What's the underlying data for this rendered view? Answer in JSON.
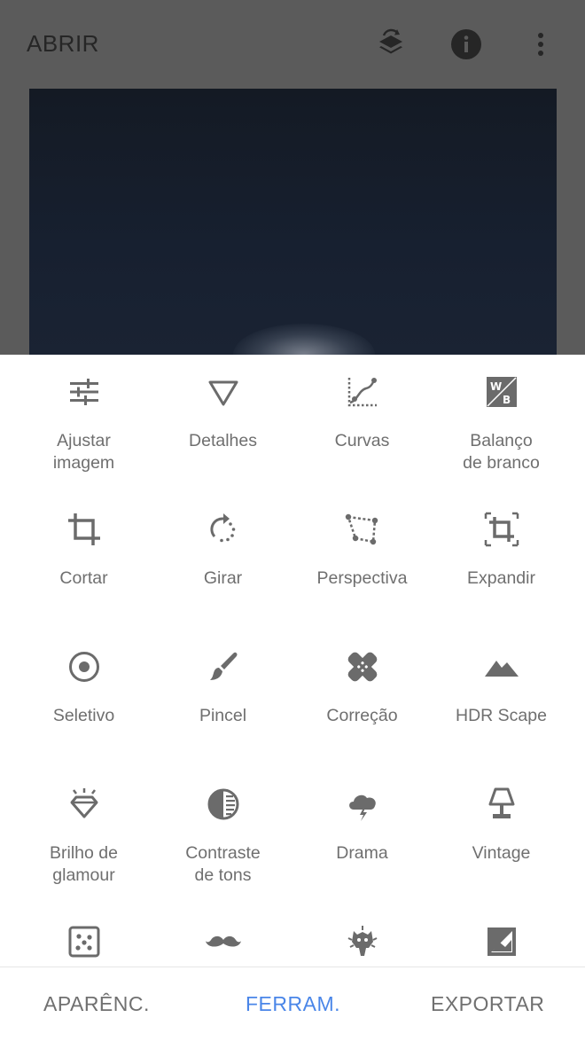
{
  "header": {
    "open_label": "ABRIR",
    "icons": [
      "layers-undo-icon",
      "info-icon",
      "more-vert-icon"
    ]
  },
  "colors": {
    "active": "#4a86e8",
    "icon": "#6b6b6b",
    "label": "#6f6f6f",
    "header_bg": "#5b5b5b"
  },
  "tools": [
    {
      "label": "Ajustar\nimagem",
      "icon": "tune-sliders-icon"
    },
    {
      "label": "Detalhes",
      "icon": "triangle-details-icon"
    },
    {
      "label": "Curvas",
      "icon": "curves-icon"
    },
    {
      "label": "Balanço\nde branco",
      "icon": "white-balance-icon"
    },
    {
      "label": "Cortar",
      "icon": "crop-icon"
    },
    {
      "label": "Girar",
      "icon": "rotate-icon"
    },
    {
      "label": "Perspectiva",
      "icon": "perspective-icon"
    },
    {
      "label": "Expandir",
      "icon": "expand-icon"
    },
    {
      "label": "Seletivo",
      "icon": "selective-icon"
    },
    {
      "label": "Pincel",
      "icon": "brush-icon"
    },
    {
      "label": "Correção",
      "icon": "healing-icon"
    },
    {
      "label": "HDR Scape",
      "icon": "hdr-mountains-icon"
    },
    {
      "label": "Brilho de\nglamour",
      "icon": "glamour-diamond-icon"
    },
    {
      "label": "Contraste\nde tons",
      "icon": "tonal-contrast-icon"
    },
    {
      "label": "Drama",
      "icon": "drama-cloud-icon"
    },
    {
      "label": "Vintage",
      "icon": "vintage-lamp-icon"
    },
    {
      "label": "",
      "icon": "grainy-film-icon"
    },
    {
      "label": "",
      "icon": "mustache-icon"
    },
    {
      "label": "",
      "icon": "grunge-icon"
    },
    {
      "label": "",
      "icon": "black-white-icon"
    }
  ],
  "bottom_nav": {
    "looks": "APARÊNC.",
    "tools": "FERRAM.",
    "export": "EXPORTAR",
    "active": "tools"
  }
}
